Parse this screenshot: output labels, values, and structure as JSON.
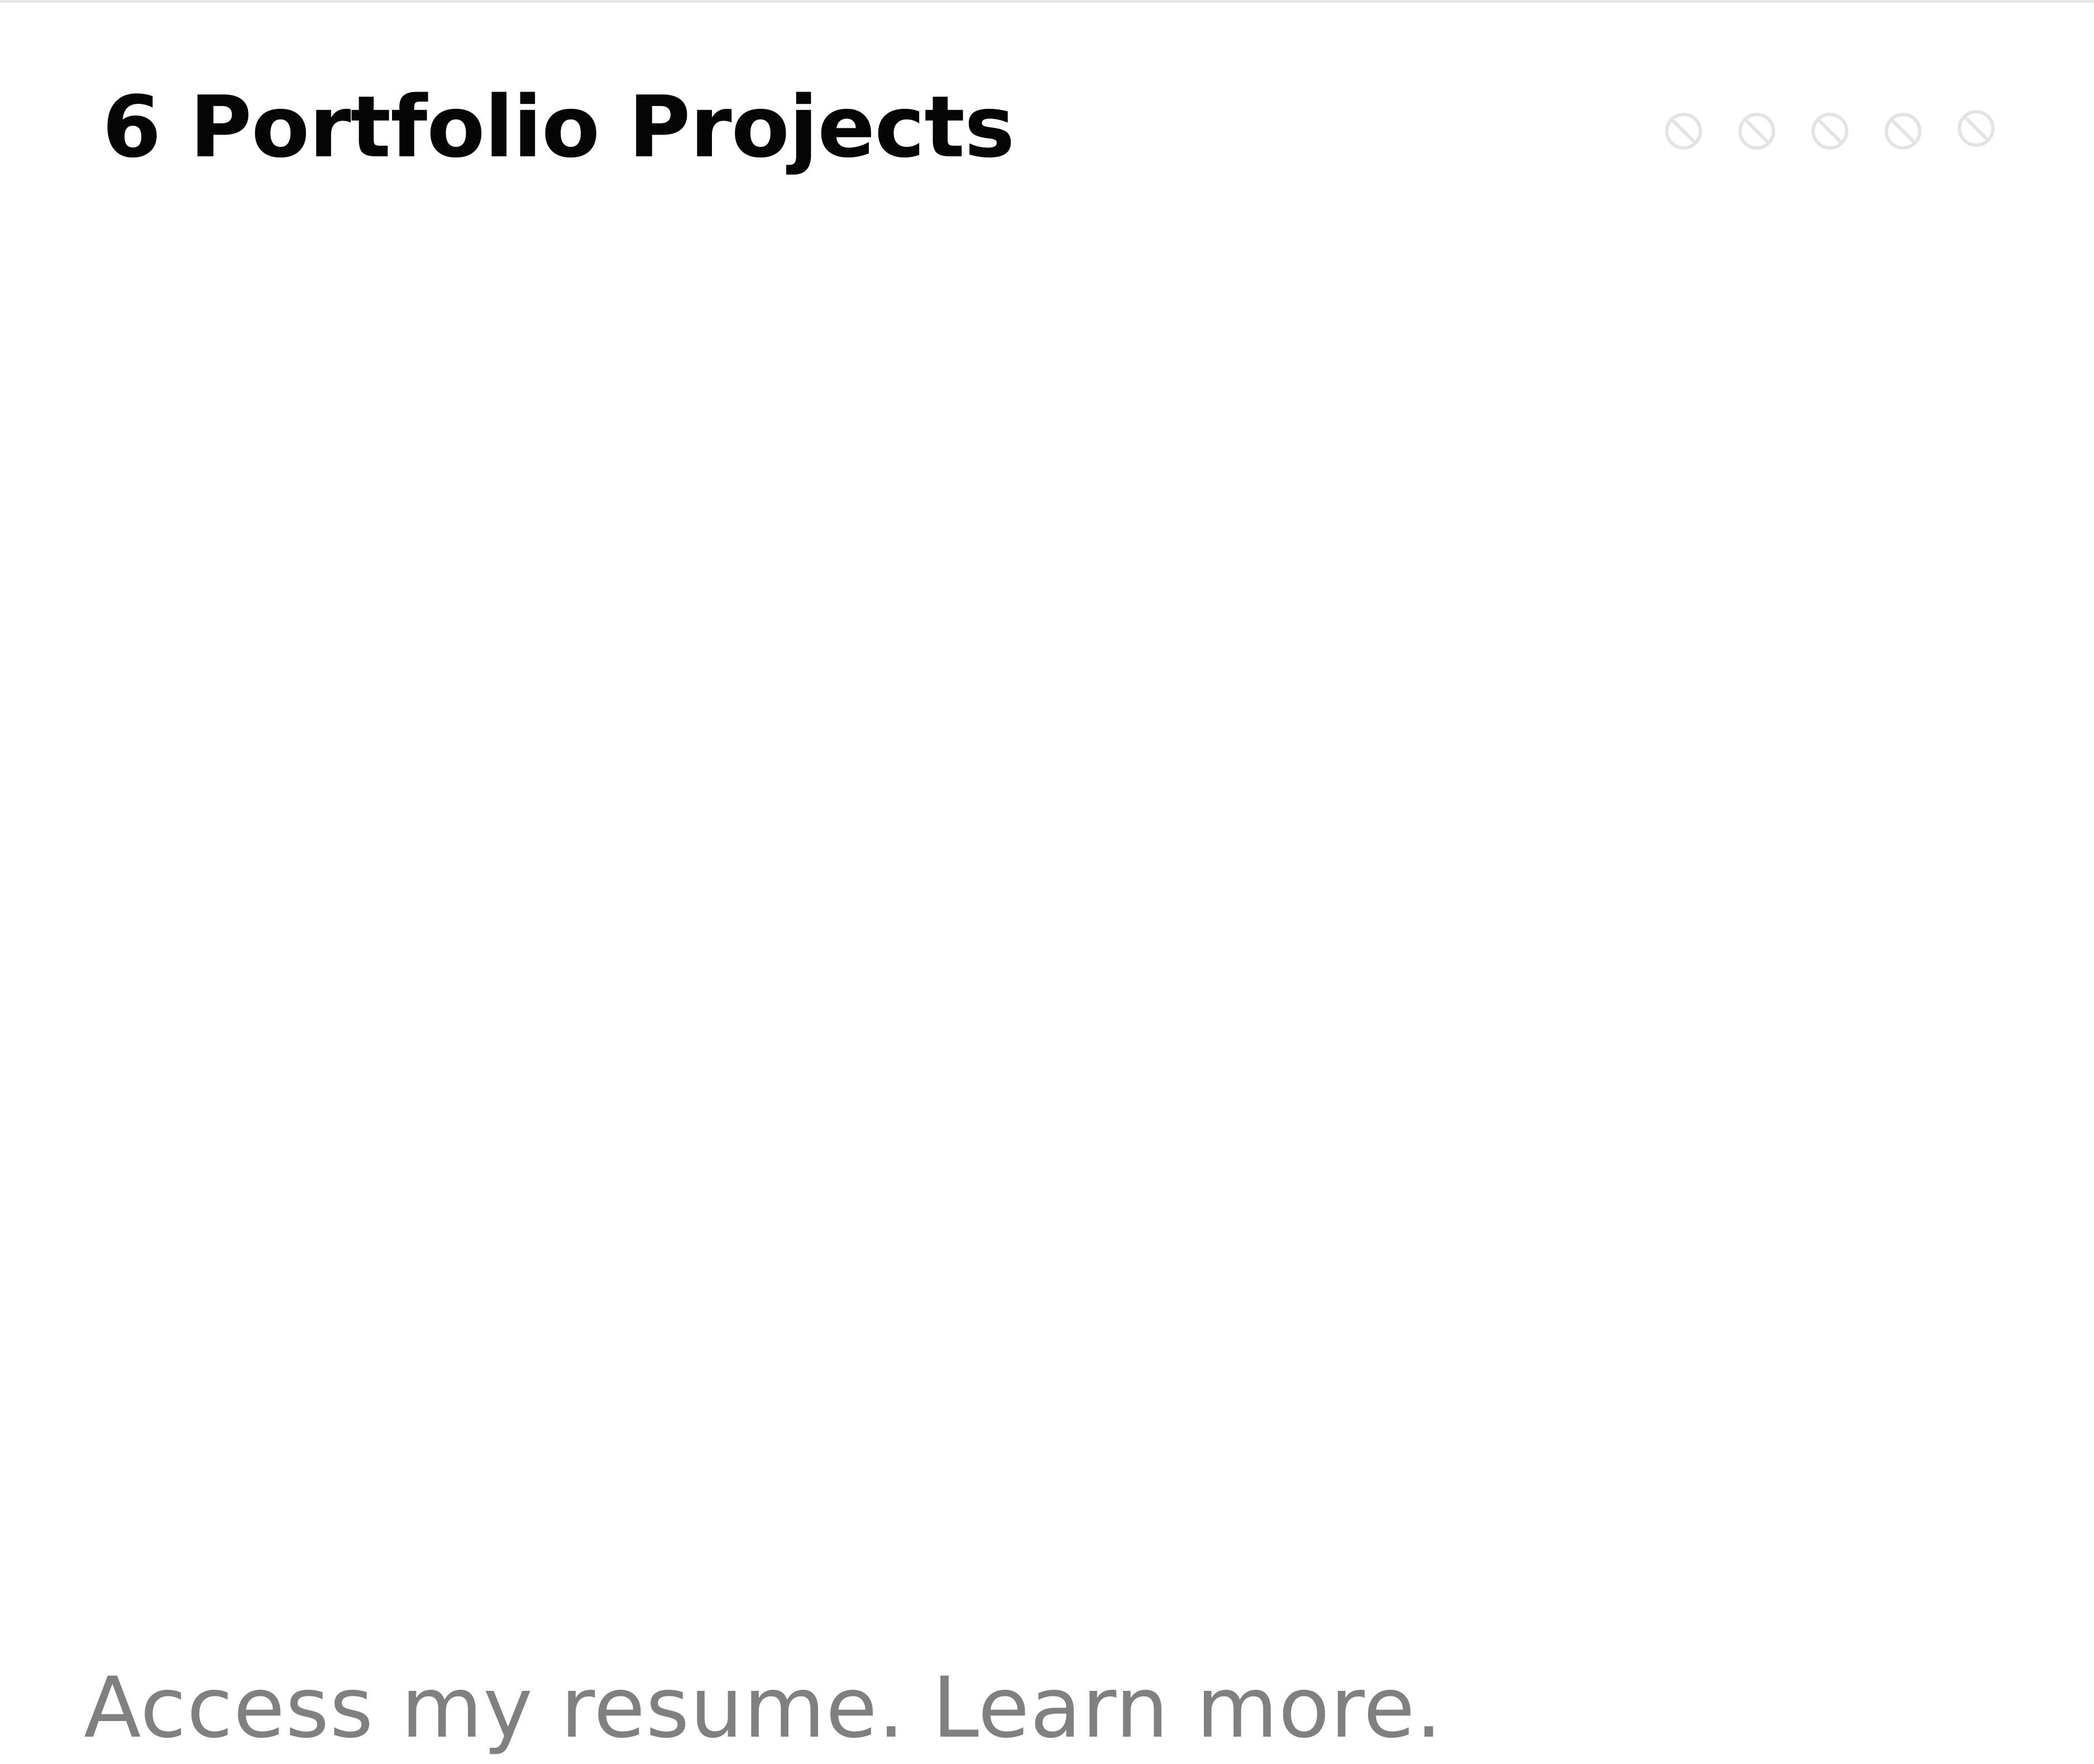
{
  "header": {
    "title": "6 Portfolio Projects"
  },
  "carousel": {
    "indicator_icon": "blocked-circle-icon",
    "indicator_color": "#e3e3e3",
    "indicator_count": 5
  },
  "footer": {
    "link_text": "Access my resume. Learn more."
  },
  "colors": {
    "background": "#ffffff",
    "title": "#050505",
    "footer_text": "#808080",
    "top_rule": "#e6e6e6"
  }
}
